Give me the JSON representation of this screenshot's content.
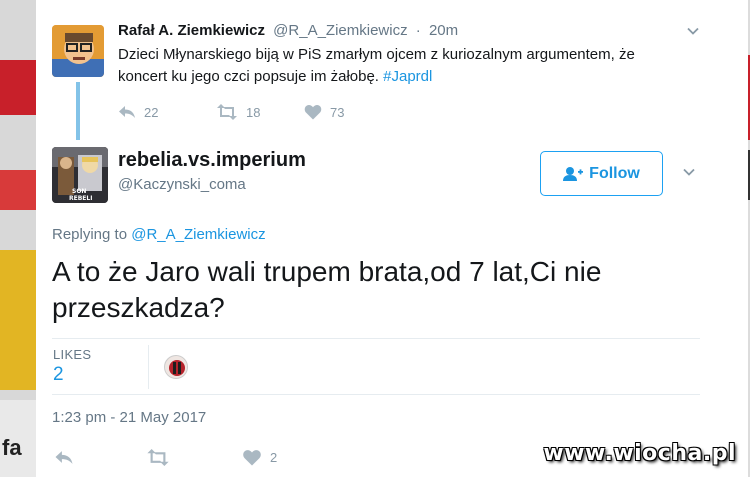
{
  "parent_tweet": {
    "author_name": "Rafał A. Ziemkiewicz",
    "author_handle": "@R_A_Ziemkiewicz",
    "separator": "·",
    "time": "20m",
    "text": "Dzieci Młynarskiego biją w PiS zmarłym ojcem z kuriozalnym argumentem, że koncert ku jego czci popsuje im żałobę.",
    "hashtag": "#Japrdl",
    "replies": "22",
    "retweets": "18",
    "likes": "73"
  },
  "main_tweet": {
    "author_name": "rebelia.vs.imperium",
    "author_handle": "@Kaczynski_coma",
    "follow_label": "Follow",
    "replying_prefix": "Replying to",
    "replying_to": "@R_A_Ziemkiewicz",
    "text": "A to że Jaro wali trupem brata,od 7 lat,Ci nie przeszkadza?",
    "likes_label": "LIKES",
    "likes_count": "2",
    "timestamp": "1:23 pm - 21 May 2017",
    "action_likes": "2",
    "avatar_text": "SON\nREBELI"
  },
  "background": {
    "fragment_text": "fa"
  },
  "watermark": "www.wiocha.pl",
  "colors": {
    "link_blue": "#1b95e0",
    "thread_line": "#83c3e8",
    "muted_text": "#657786",
    "icon_gray": "#aab8c2"
  }
}
